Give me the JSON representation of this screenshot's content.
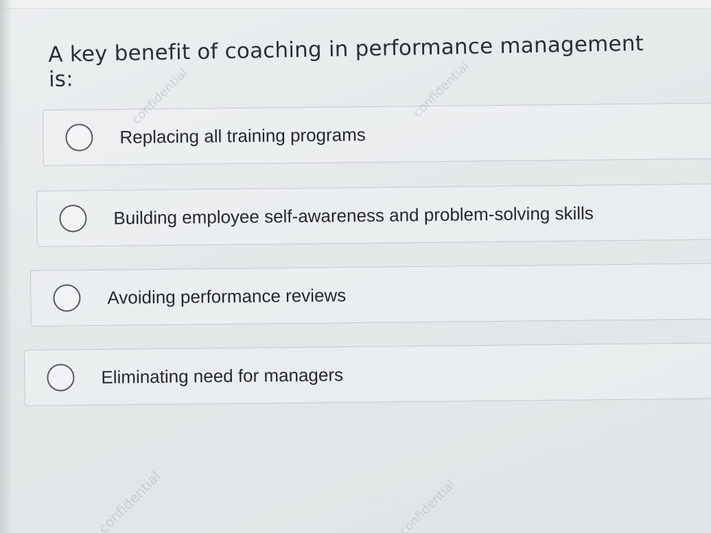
{
  "question": {
    "text": "A key benefit of coaching in performance management is:"
  },
  "options": [
    {
      "label": "Replacing all training programs",
      "selected": false
    },
    {
      "label": "Building employee self-awareness and problem-solving skills",
      "selected": false
    },
    {
      "label": "Avoiding performance reviews",
      "selected": false
    },
    {
      "label": "Eliminating need for managers",
      "selected": false
    }
  ],
  "watermark": {
    "text": "confidential"
  }
}
